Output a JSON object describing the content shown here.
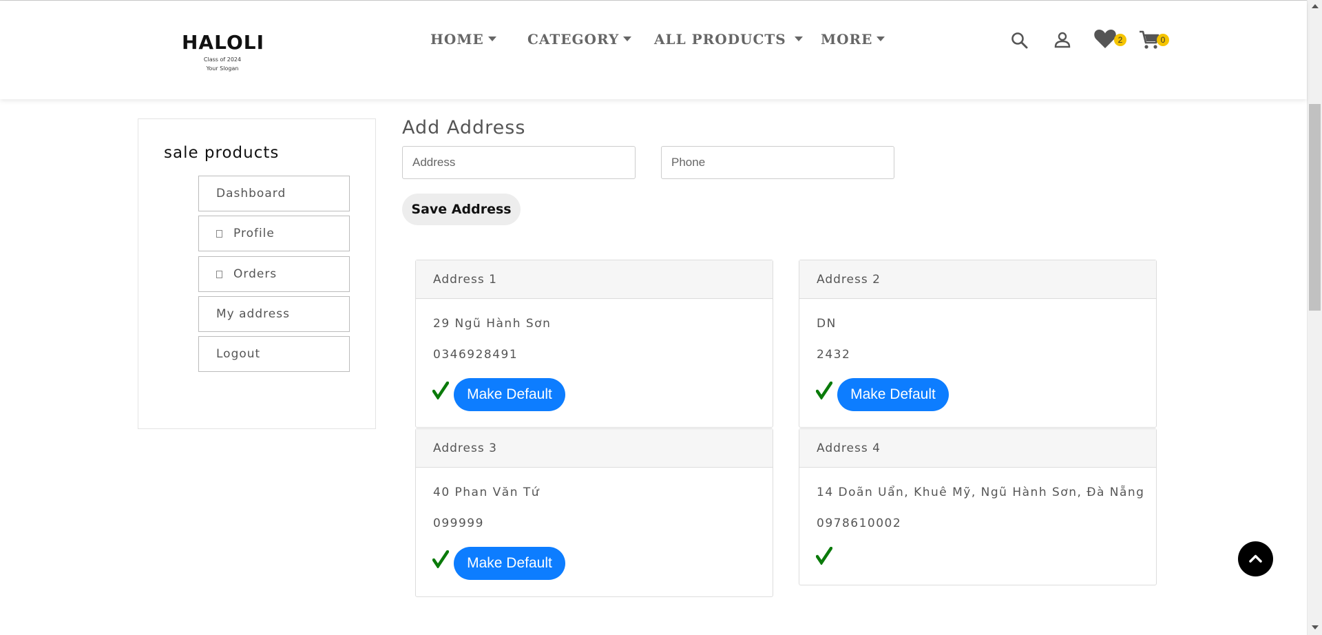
{
  "header": {
    "logo_name": "HALOLI",
    "logo_line1": "Class of 2024",
    "logo_line2": "Your Slogan",
    "nav": [
      {
        "label": "HOME"
      },
      {
        "label": "CATEGORY"
      },
      {
        "label": "ALL PRODUCTS"
      },
      {
        "label": "MORE"
      }
    ],
    "wishlist_count": "2",
    "cart_count": "0"
  },
  "sidebar": {
    "title": "sale products",
    "items": [
      {
        "label": "Dashboard"
      },
      {
        "label": "Profile"
      },
      {
        "label": "Orders"
      },
      {
        "label": "My address"
      },
      {
        "label": "Logout"
      }
    ]
  },
  "form": {
    "title": "Add Address",
    "address_placeholder": "Address",
    "phone_placeholder": "Phone",
    "save_label": "Save Address"
  },
  "addresses": [
    {
      "title": "Address 1",
      "address": "29 Ngũ Hành Sơn",
      "phone": "0346928491",
      "make_default": "Make Default"
    },
    {
      "title": "Address 2",
      "address": "DN",
      "phone": "2432",
      "make_default": "Make Default"
    },
    {
      "title": "Address 3",
      "address": "40 Phan Văn Tứ",
      "phone": "099999",
      "make_default": "Make Default"
    },
    {
      "title": "Address 4",
      "address": "14 Doãn Uẩn, Khuê Mỹ, Ngũ Hành Sơn, Đà Nẵng",
      "phone": "0978610002"
    }
  ],
  "colors": {
    "accent": "#0d7dff",
    "badge": "#f5c400",
    "check": "#0a7a0a"
  },
  "icons": {
    "search": "search-icon",
    "account": "user-icon",
    "wishlist": "heart-icon",
    "cart": "cart-icon",
    "check": "check-icon",
    "to_top": "chevron-up-icon"
  }
}
